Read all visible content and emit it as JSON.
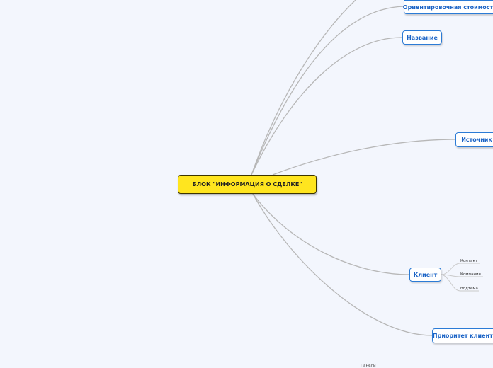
{
  "central": {
    "label": "БЛОК \"ИНФОРМАЦИЯ О СДЕЛКЕ\""
  },
  "branches": [
    {
      "id": "estimate",
      "label": "Ориентировочная стоимость"
    },
    {
      "id": "name",
      "label": "Название"
    },
    {
      "id": "source",
      "label": "Источник"
    },
    {
      "id": "client",
      "label": "Клиент",
      "children": [
        "Контакт",
        "Компания",
        "подтема"
      ]
    },
    {
      "id": "priority",
      "label": "Приоритет клиента"
    }
  ],
  "bottom_label": "Панели",
  "colors": {
    "central_fill": "#ffe51f",
    "node_border": "#2b7bd6",
    "node_text": "#1a63c6",
    "connector": "#b7b7b7",
    "background": "#f3f6fd"
  }
}
